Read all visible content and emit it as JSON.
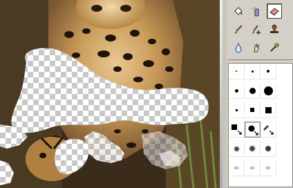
{
  "canvas": {
    "image": "leopard-photo",
    "checker_colors": [
      "#ffffff",
      "#c8c8c8"
    ]
  },
  "tools": [
    {
      "name": "paint-bucket-icon"
    },
    {
      "name": "airbrush-icon"
    },
    {
      "name": "eraser-icon",
      "selected": true
    },
    {
      "name": "brush-icon"
    },
    {
      "name": "pen-plus-icon"
    },
    {
      "name": "stamp-icon"
    },
    {
      "name": "water-drop-icon"
    },
    {
      "name": "smudge-icon"
    },
    {
      "name": "dropper-icon"
    }
  ],
  "brushes": [
    {
      "shape": "dot",
      "size": 2
    },
    {
      "shape": "dot",
      "size": 3
    },
    {
      "shape": "dot",
      "size": 4
    },
    {
      "shape": "dot",
      "size": 5
    },
    {
      "shape": "dot",
      "size": 9
    },
    {
      "shape": "dot",
      "size": 13
    },
    {
      "shape": "square",
      "size": 3
    },
    {
      "shape": "square",
      "size": 6
    },
    {
      "shape": "square",
      "size": 9
    },
    {
      "shape": "square-arrow",
      "size": 8
    },
    {
      "shape": "dot-arrow",
      "size": 9,
      "selected": true
    },
    {
      "shape": "diag-arrow",
      "size": 8
    },
    {
      "shape": "soft",
      "size": 7
    },
    {
      "shape": "soft",
      "size": 8
    },
    {
      "shape": "soft",
      "size": 8
    },
    {
      "shape": "faint",
      "size": 6
    },
    {
      "shape": "faint",
      "size": 6
    },
    {
      "shape": "faint",
      "size": 6
    }
  ],
  "colors": {
    "panel_bg": "#d4d0c8",
    "selected_border": "#404040"
  }
}
